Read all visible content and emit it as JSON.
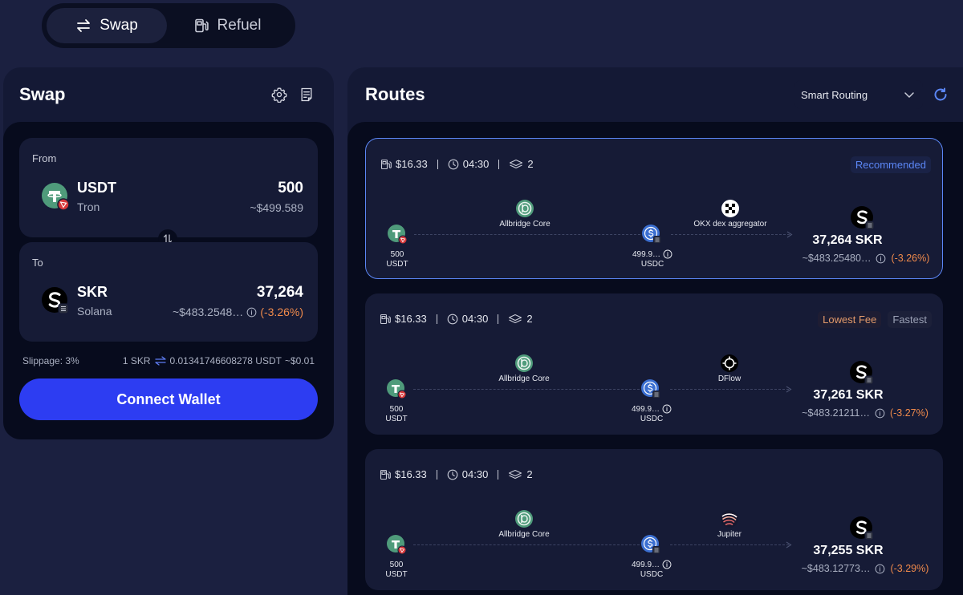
{
  "mode_toggle": {
    "swap_label": "Swap",
    "refuel_label": "Refuel"
  },
  "swap": {
    "title": "Swap",
    "from": {
      "label": "From",
      "symbol": "USDT",
      "chain": "Tron",
      "amount": "500",
      "usd": "~$499.589"
    },
    "to": {
      "label": "To",
      "symbol": "SKR",
      "chain": "Solana",
      "amount": "37,264",
      "usd": "~$483.2548…",
      "change": "(-3.26%)"
    },
    "slippage": "Slippage: 3%",
    "rate_left": "1 SKR",
    "rate_right": "0.01341746608278 USDT",
    "rate_usd": "~$0.01",
    "connect_label": "Connect Wallet"
  },
  "routes": {
    "title": "Routes",
    "routing_mode": "Smart Routing",
    "items": [
      {
        "fee": "$16.33",
        "time": "04:30",
        "steps": "2",
        "tags": [
          "Recommended"
        ],
        "src_amount": "500",
        "src_symbol": "USDT",
        "bridge": "Allbridge Core",
        "mid_amount": "499.9…",
        "mid_symbol": "USDC",
        "dex": "OKX dex aggregator",
        "dest_amount": "37,264 SKR",
        "dest_usd": "~$483.25480…",
        "dest_change": "(-3.26%)"
      },
      {
        "fee": "$16.33",
        "time": "04:30",
        "steps": "2",
        "tags": [
          "Lowest Fee",
          "Fastest"
        ],
        "src_amount": "500",
        "src_symbol": "USDT",
        "bridge": "Allbridge Core",
        "mid_amount": "499.9…",
        "mid_symbol": "USDC",
        "dex": "DFlow",
        "dest_amount": "37,261 SKR",
        "dest_usd": "~$483.21211…",
        "dest_change": "(-3.27%)"
      },
      {
        "fee": "$16.33",
        "time": "04:30",
        "steps": "2",
        "tags": [],
        "src_amount": "500",
        "src_symbol": "USDT",
        "bridge": "Allbridge Core",
        "mid_amount": "499.9…",
        "mid_symbol": "USDC",
        "dex": "Jupiter",
        "dest_amount": "37,255 SKR",
        "dest_usd": "~$483.12773…",
        "dest_change": "(-3.29%)"
      }
    ]
  },
  "colors": {
    "background": "#1b2040",
    "panel": "#141935",
    "inner": "#070b1d",
    "card": "#161b36",
    "accent": "#2d3df2",
    "recommended": "#5b86f5",
    "negative": "#f08a4b"
  },
  "icons": [
    "swap-arrows-icon",
    "fuel-pump-icon",
    "gear-icon",
    "receipt-icon",
    "tether-icon",
    "tron-icon",
    "skr-icon",
    "solana-icon",
    "flip-icon",
    "info-icon",
    "chevron-down-icon",
    "refresh-icon",
    "gas-icon",
    "clock-icon",
    "layers-icon",
    "allbridge-icon",
    "usdc-icon",
    "okx-icon",
    "dflow-icon",
    "jupiter-icon"
  ]
}
